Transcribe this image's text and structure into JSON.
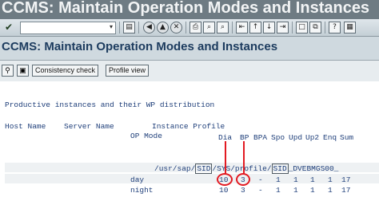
{
  "window": {
    "title": "CCMS: Maintain Operation Modes and Instances"
  },
  "toolbar": {
    "check_icon": "✔",
    "command_placeholder": "",
    "icons": [
      "save-icon",
      "back-icon",
      "exit-icon",
      "cancel-icon",
      "print-icon",
      "find-icon",
      "find-next-icon",
      "first-page-icon",
      "prev-page-icon",
      "next-page-icon",
      "last-page-icon",
      "new-session-icon",
      "shortcut-icon",
      "help-icon",
      "layout-icon"
    ]
  },
  "page": {
    "title": "CCMS: Maintain Operation Modes and Instances"
  },
  "app_toolbar": {
    "consistency_check": "Consistency check",
    "profile_view": "Profile view"
  },
  "list": {
    "section_title": "Productive instances and their WP distribution",
    "headers": {
      "host_name": "Host Name",
      "server_name": "Server Name",
      "instance_profile": "Instance Profile",
      "op_mode": "OP Mode",
      "dia": "Dia",
      "bp": "BP",
      "bpa": "BPA",
      "spo": "Spo",
      "upd": "Upd",
      "up2": "Up2",
      "enq": "Enq",
      "sum": "Sum"
    },
    "profile_path": {
      "prefix": "/usr/sap/",
      "sid1": "SID",
      "mid": "/SYS/profile/",
      "sid2": "SID",
      "suffix": "_DVEBMGS00_"
    },
    "rows": [
      {
        "mode": "day",
        "dia": "10",
        "bp": "3",
        "bpa": "-",
        "spo": "1",
        "upd": "1",
        "up2": "1",
        "enq": "1",
        "sum": "17"
      },
      {
        "mode": "night",
        "dia": "10",
        "bp": "3",
        "bpa": "-",
        "spo": "1",
        "upd": "1",
        "up2": "1",
        "enq": "1",
        "sum": "17"
      }
    ]
  },
  "colors": {
    "title_band": "#6e7b83",
    "annotation": "#e21a22",
    "list_text": "#1f3f7a"
  }
}
